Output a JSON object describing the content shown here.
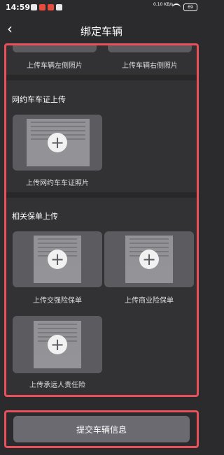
{
  "status_bar": {
    "time": "14:59",
    "net_speed": "0.10\nKB/s",
    "battery": "69"
  },
  "header": {
    "title": "绑定车辆"
  },
  "vehicle_photos": {
    "left_label": "上传车辆左侧照片",
    "right_label": "上传车辆右侧照片"
  },
  "ride_permit": {
    "section_title": "网约车车证上传",
    "upload_label": "上传网约车车证照片"
  },
  "insurance": {
    "section_title": "相关保单上传",
    "items": [
      {
        "label": "上传交强险保单"
      },
      {
        "label": "上传商业险保单"
      },
      {
        "label": "上传承运人责任险"
      }
    ]
  },
  "plus_glyph": "+",
  "back_glyph": "‹",
  "footer": {
    "submit_label": "提交车辆信息"
  }
}
